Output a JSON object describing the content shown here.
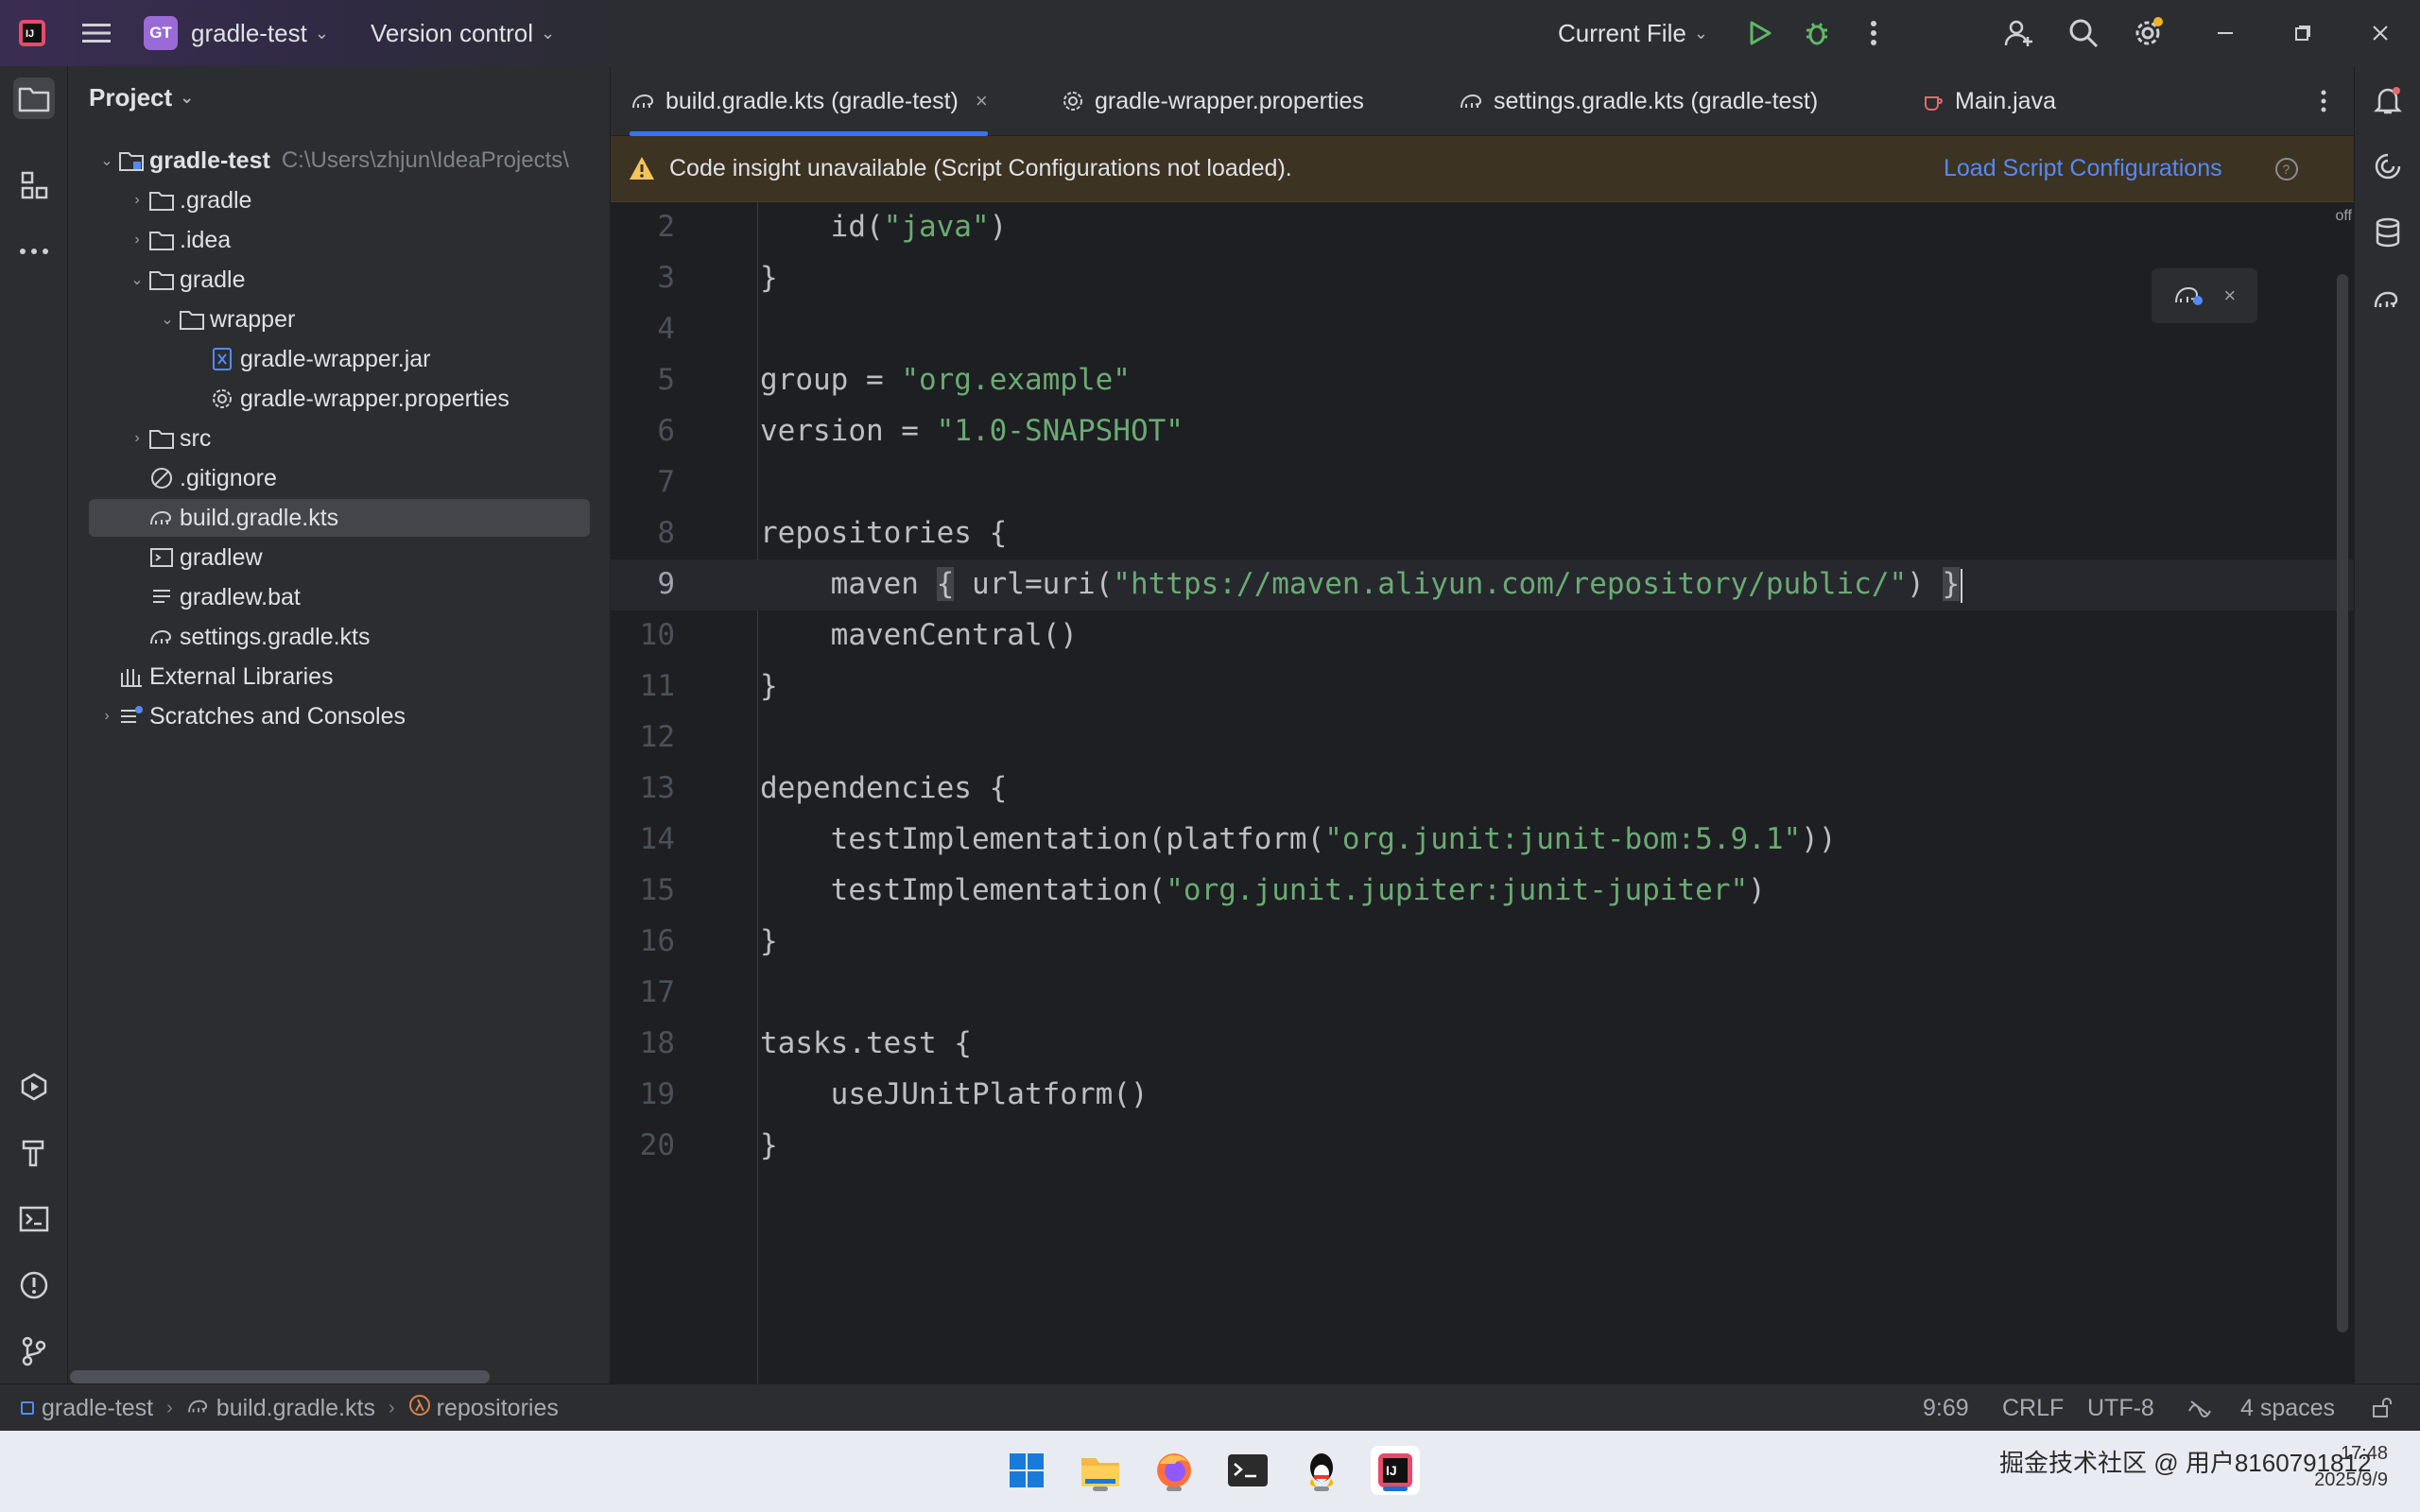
{
  "titlebar": {
    "project_badge": "GT",
    "project_name": "gradle-test",
    "vcs_label": "Version control",
    "run_config": "Current File"
  },
  "project_panel": {
    "title": "Project",
    "tree": [
      {
        "label": "gradle-test",
        "path": "C:\\Users\\zhjun\\IdeaProjects\\",
        "icon": "module-folder-icon"
      },
      {
        "label": ".gradle",
        "icon": "folder-icon"
      },
      {
        "label": ".idea",
        "icon": "folder-icon"
      },
      {
        "label": "gradle",
        "icon": "folder-icon"
      },
      {
        "label": "wrapper",
        "icon": "folder-icon"
      },
      {
        "label": "gradle-wrapper.jar",
        "icon": "jar-icon"
      },
      {
        "label": "gradle-wrapper.properties",
        "icon": "gear-icon"
      },
      {
        "label": "src",
        "icon": "folder-icon"
      },
      {
        "label": ".gitignore",
        "icon": "ignore-icon"
      },
      {
        "label": "build.gradle.kts",
        "icon": "gradle-icon"
      },
      {
        "label": "gradlew",
        "icon": "terminal-icon"
      },
      {
        "label": "gradlew.bat",
        "icon": "text-file-icon"
      },
      {
        "label": "settings.gradle.kts",
        "icon": "gradle-icon"
      },
      {
        "label": "External Libraries",
        "icon": "library-icon"
      },
      {
        "label": "Scratches and Consoles",
        "icon": "scratches-icon"
      }
    ]
  },
  "tabs": [
    {
      "label": "build.gradle.kts (gradle-test)",
      "icon": "gradle-icon"
    },
    {
      "label": "gradle-wrapper.properties",
      "icon": "gear-icon"
    },
    {
      "label": "settings.gradle.kts (gradle-test)",
      "icon": "gradle-icon"
    },
    {
      "label": "Main.java",
      "icon": "java-icon"
    }
  ],
  "banner": {
    "message": "Code insight unavailable (Script Configurations not loaded).",
    "action": "Load Script Configurations"
  },
  "editor": {
    "off_label": "off",
    "lines": [
      {
        "n": "2",
        "indent": "    ",
        "pre": "id(",
        "str": "\"java\"",
        "post": ")"
      },
      {
        "n": "3",
        "indent": "",
        "pre": "}",
        "str": "",
        "post": ""
      },
      {
        "n": "4",
        "indent": "",
        "pre": "",
        "str": "",
        "post": ""
      },
      {
        "n": "5",
        "indent": "",
        "pre": "group = ",
        "str": "\"org.example\"",
        "post": ""
      },
      {
        "n": "6",
        "indent": "",
        "pre": "version = ",
        "str": "\"1.0-SNAPSHOT\"",
        "post": ""
      },
      {
        "n": "7",
        "indent": "",
        "pre": "",
        "str": "",
        "post": ""
      },
      {
        "n": "8",
        "indent": "",
        "pre": "repositories {",
        "str": "",
        "post": ""
      },
      {
        "n": "9",
        "indent": "    ",
        "pre": "maven ",
        "brace_open": "{",
        "pre2": " url=uri(",
        "str": "\"https://maven.aliyun.com/repository/public/\"",
        "post": ") ",
        "brace_close": "}"
      },
      {
        "n": "10",
        "indent": "    ",
        "pre": "mavenCentral()",
        "str": "",
        "post": ""
      },
      {
        "n": "11",
        "indent": "",
        "pre": "}",
        "str": "",
        "post": ""
      },
      {
        "n": "12",
        "indent": "",
        "pre": "",
        "str": "",
        "post": ""
      },
      {
        "n": "13",
        "indent": "",
        "pre": "dependencies {",
        "str": "",
        "post": ""
      },
      {
        "n": "14",
        "indent": "    ",
        "pre": "testImplementation(platform(",
        "str": "\"org.junit:junit-bom:5.9.1\"",
        "post": "))"
      },
      {
        "n": "15",
        "indent": "    ",
        "pre": "testImplementation(",
        "str": "\"org.junit.jupiter:junit-jupiter\"",
        "post": ")"
      },
      {
        "n": "16",
        "indent": "",
        "pre": "}",
        "str": "",
        "post": ""
      },
      {
        "n": "17",
        "indent": "",
        "pre": "",
        "str": "",
        "post": ""
      },
      {
        "n": "18",
        "indent": "",
        "pre": "tasks.test {",
        "str": "",
        "post": ""
      },
      {
        "n": "19",
        "indent": "    ",
        "pre": "useJUnitPlatform()",
        "str": "",
        "post": ""
      },
      {
        "n": "20",
        "indent": "",
        "pre": "}",
        "str": "",
        "post": ""
      }
    ]
  },
  "statusbar": {
    "crumb_project": "gradle-test",
    "crumb_file": "build.gradle.kts",
    "crumb_symbol": "repositories",
    "position": "9:69",
    "line_sep": "CRLF",
    "encoding": "UTF-8",
    "indent": "4 spaces"
  },
  "taskbar": {
    "tray_text": "掘金技术社区 @ 用户8160791812",
    "time": "17:48",
    "date": "2025/9/9"
  },
  "colors": {
    "accent": "#3574f0",
    "string": "#6aab73",
    "banner_bg": "#3d3323",
    "run_green": "#5fb865"
  }
}
